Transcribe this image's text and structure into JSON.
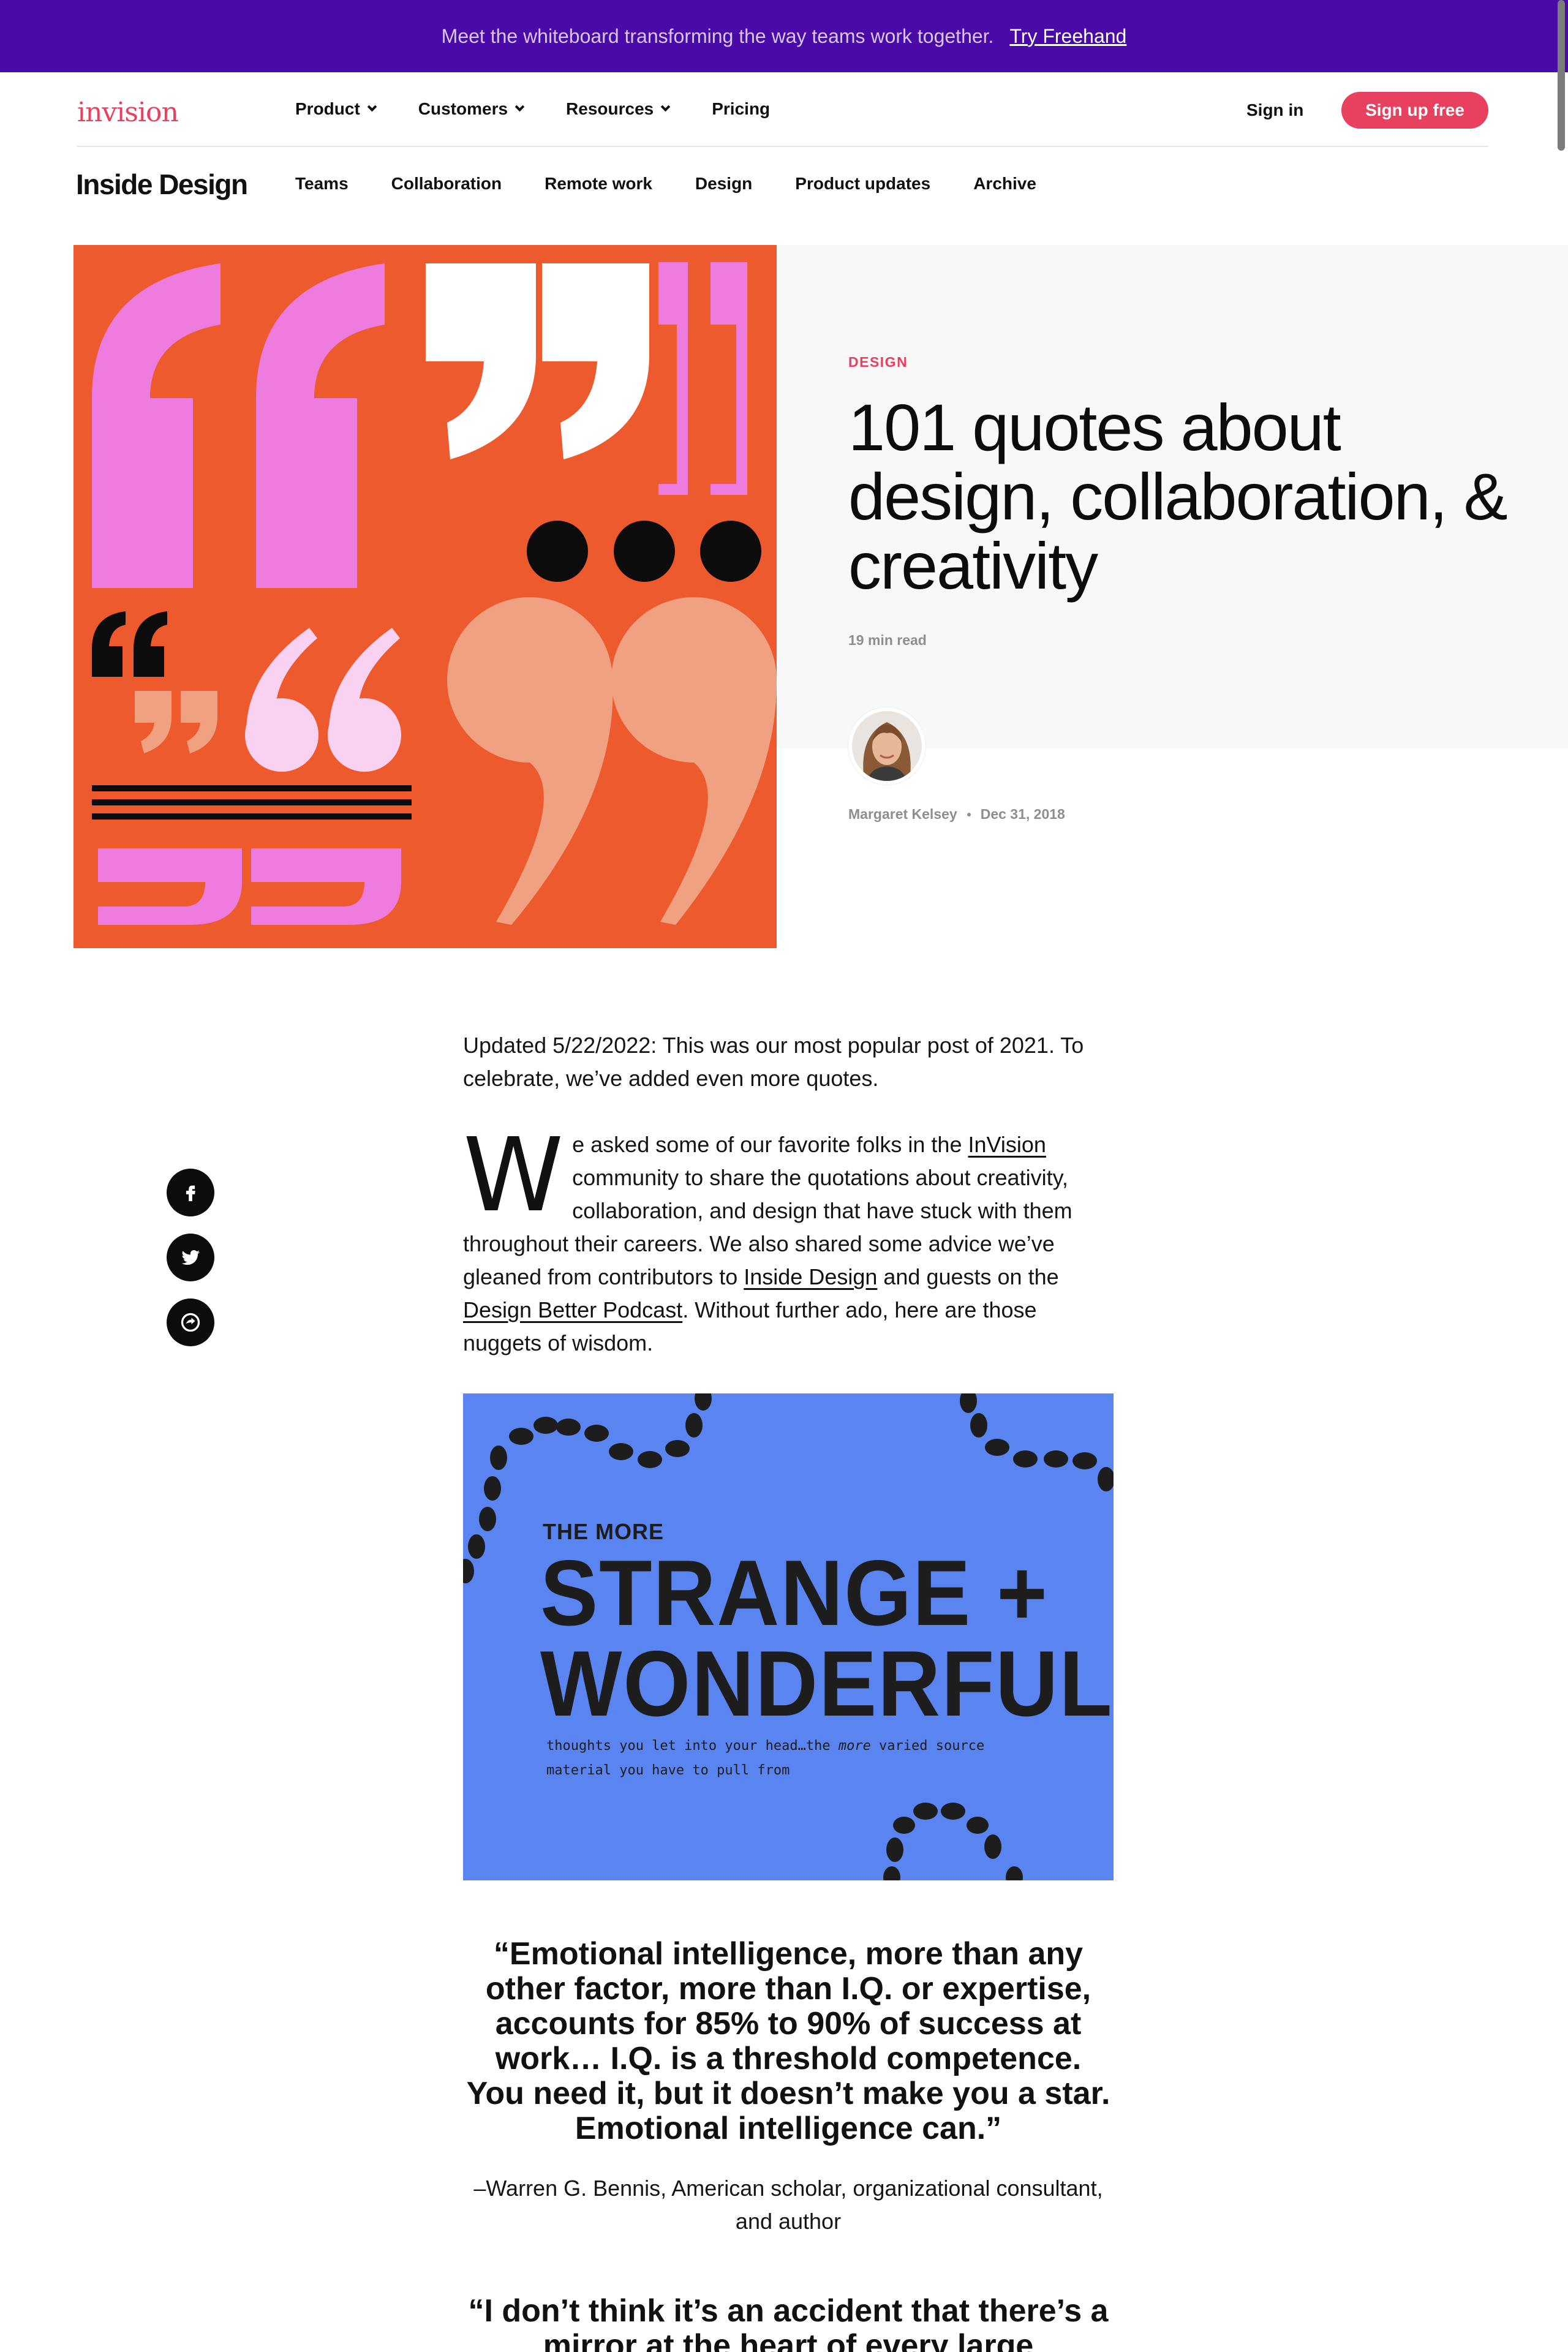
{
  "promo": {
    "text": "Meet the whiteboard transforming the way teams work together.",
    "link": "Try Freehand"
  },
  "nav": {
    "logo": "invision",
    "items": [
      {
        "label": "Product",
        "dropdown": true
      },
      {
        "label": "Customers",
        "dropdown": true
      },
      {
        "label": "Resources",
        "dropdown": true
      },
      {
        "label": "Pricing",
        "dropdown": false
      }
    ],
    "signin": "Sign in",
    "signup": "Sign up free"
  },
  "subnav": {
    "brand": "Inside Design",
    "items": [
      "Teams",
      "Collaboration",
      "Remote work",
      "Design",
      "Product updates",
      "Archive"
    ]
  },
  "hero": {
    "category": "DESIGN",
    "title": "101 quotes about design, collaboration, & creativity",
    "read_time": "19 min read",
    "author": "Margaret Kelsey",
    "date": "Dec 31, 2018"
  },
  "share": {
    "icons": [
      "facebook-icon",
      "twitter-icon",
      "link-share-icon"
    ]
  },
  "article": {
    "updated": "Updated 5/22/2022: This was our most popular post of 2021. To celebrate, we’ve added even more quotes.",
    "intro": {
      "dropcap": "W",
      "part1": "e asked some of our favorite folks in the ",
      "link1": "InVision",
      "part2": " community to share the quotations about creativity, collaboration, and design that have stuck with them throughout their careers. We also shared some advice we’ve gleaned from contributors to ",
      "link2": "Inside Design",
      "part3": " and guests on the ",
      "link3": "Design Better Podcast",
      "part4": ". Without further ado, here are those nuggets of wisdom."
    },
    "illustration": {
      "kicker": "THE MORE",
      "line1": "STRANGE +",
      "line2": "WONDERFUL",
      "small_a": "thoughts you let into your head…the ",
      "small_em": "more",
      "small_b": " varied source material you have to pull from"
    },
    "quote1": "“Emotional intelligence, more than any other factor, more than I.Q. or expertise, accounts for 85% to 90% of success at work… I.Q. is a threshold competence. You need it, but it doesn’t make you a star. Emotional intelligence can.”",
    "attribution1": "–Warren G. Bennis, American scholar, organizational consultant, and author",
    "quote2": "“I don’t think it’s an accident that there’s a mirror at the heart of every large"
  },
  "colors": {
    "accent": "#e8405f",
    "promo_bg": "#4a0aa8",
    "hero_orange": "#ec5a2d",
    "illustration_blue": "#5a85f0"
  }
}
